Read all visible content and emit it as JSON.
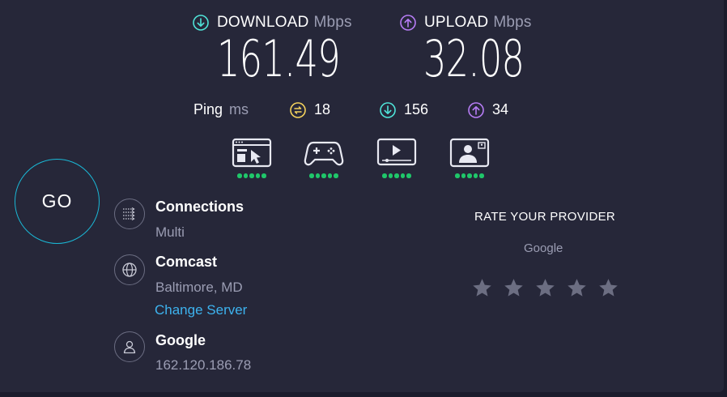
{
  "download": {
    "label": "DOWNLOAD",
    "unit": "Mbps",
    "value": "161.49"
  },
  "upload": {
    "label": "UPLOAD",
    "unit": "Mbps",
    "value": "32.08"
  },
  "ping": {
    "label": "Ping",
    "unit": "ms",
    "idle": "18",
    "download": "156",
    "upload": "34"
  },
  "activities": [
    {
      "name": "web-browsing",
      "rating": 5
    },
    {
      "name": "gaming",
      "rating": 5
    },
    {
      "name": "video-streaming",
      "rating": 5
    },
    {
      "name": "video-chat",
      "rating": 5
    }
  ],
  "go_label": "GO",
  "connections": {
    "title": "Connections",
    "value": "Multi"
  },
  "server": {
    "title": "Comcast",
    "location": "Baltimore, MD",
    "change_label": "Change Server"
  },
  "provider": {
    "title": "Google",
    "ip": "162.120.186.78"
  },
  "rate": {
    "title": "RATE YOUR PROVIDER",
    "provider": "Google",
    "stars": 5
  },
  "colors": {
    "download_accent": "#4fe3d8",
    "upload_accent": "#b67cf5",
    "ping_accent": "#f4d25c",
    "go_ring": "#1ab8d6",
    "good": "#1fc76a",
    "link": "#3db3ef"
  }
}
